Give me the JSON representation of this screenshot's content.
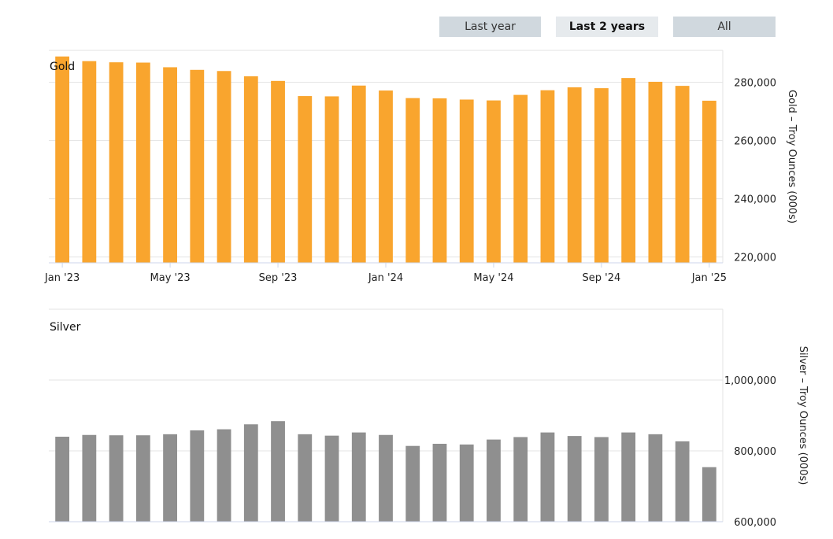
{
  "range_buttons": [
    {
      "label": "Last year",
      "active": false
    },
    {
      "label": "Last 2 years",
      "active": true
    },
    {
      "label": "All",
      "active": false
    }
  ],
  "colors": {
    "gold": "#f9a52e",
    "silver": "#8f8f8f",
    "grid": "#e3e3e3",
    "button": "#d0d8de",
    "button_active": "#e6eaed"
  },
  "chart_data": [
    {
      "type": "bar",
      "title": "Gold",
      "ylabel": "Gold – Troy Ounces (000s)",
      "y_axis_side": "right",
      "ylim": [
        218000,
        291000
      ],
      "yticks": [
        220000,
        240000,
        260000,
        280000
      ],
      "ytick_labels": [
        "220,000",
        "240,000",
        "260,000",
        "280,000"
      ],
      "x_tick_labels": [
        "Jan '23",
        "May '23",
        "Sep '23",
        "Jan '24",
        "May '24",
        "Sep '24",
        "Jan '25"
      ],
      "x_tick_indices": [
        0,
        4,
        8,
        12,
        16,
        20,
        24
      ],
      "categories": [
        "Jan '23",
        "Feb '23",
        "Mar '23",
        "Apr '23",
        "May '23",
        "Jun '23",
        "Jul '23",
        "Aug '23",
        "Sep '23",
        "Oct '23",
        "Nov '23",
        "Dec '23",
        "Jan '24",
        "Feb '24",
        "Mar '24",
        "Apr '24",
        "May '24",
        "Jun '24",
        "Jul '24",
        "Aug '24",
        "Sep '24",
        "Oct '24",
        "Nov '24",
        "Dec '24",
        "Jan '25"
      ],
      "values": [
        288900,
        287300,
        286900,
        286800,
        285200,
        284300,
        283900,
        282100,
        280500,
        275300,
        275200,
        278900,
        277200,
        274600,
        274500,
        274100,
        273800,
        275700,
        277300,
        278300,
        278000,
        281500,
        280200,
        278800,
        273700
      ],
      "grid": true
    },
    {
      "type": "bar",
      "title": "Silver",
      "ylabel": "Silver – Troy Ounces (000s)",
      "y_axis_side": "right",
      "ylim": [
        600000,
        1200000
      ],
      "yticks": [
        600000,
        800000,
        1000000
      ],
      "ytick_labels": [
        "600,000",
        "800,000",
        "1,000,000"
      ],
      "categories": [
        "Jan '23",
        "Feb '23",
        "Mar '23",
        "Apr '23",
        "May '23",
        "Jun '23",
        "Jul '23",
        "Aug '23",
        "Sep '23",
        "Oct '23",
        "Nov '23",
        "Dec '23",
        "Jan '24",
        "Feb '24",
        "Mar '24",
        "Apr '24",
        "May '24",
        "Jun '24",
        "Jul '24",
        "Aug '24",
        "Sep '24",
        "Oct '24",
        "Nov '24",
        "Dec '24",
        "Jan '25"
      ],
      "values": [
        840000,
        845000,
        844000,
        844000,
        847000,
        858000,
        861000,
        875000,
        884000,
        847000,
        843000,
        852000,
        845000,
        814000,
        820000,
        818000,
        832000,
        839000,
        852000,
        842000,
        839000,
        852000,
        847000,
        827000,
        754000
      ],
      "grid": true
    }
  ]
}
